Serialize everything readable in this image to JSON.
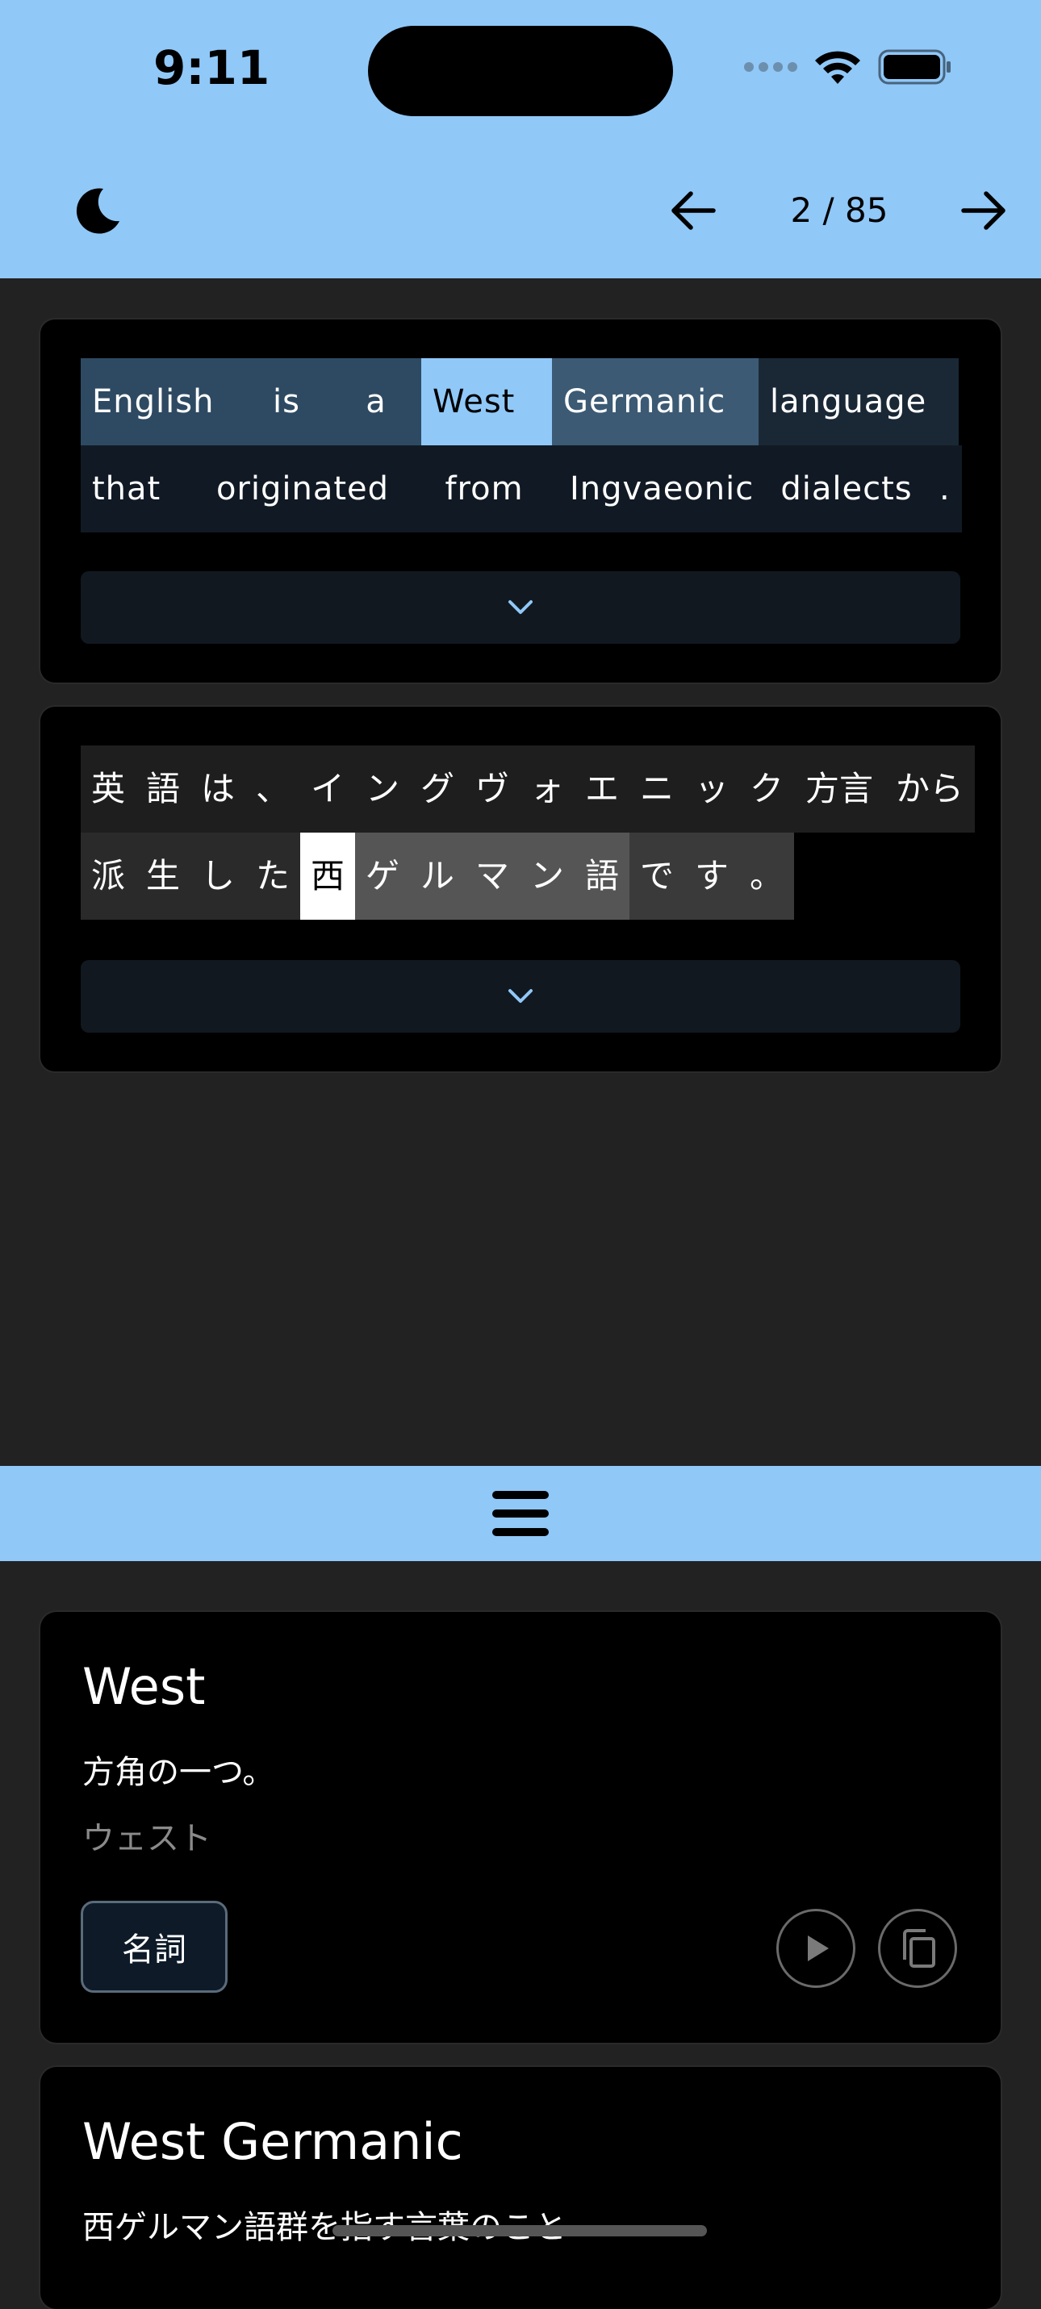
{
  "status_bar": {
    "time": "9:11"
  },
  "toolbar": {
    "page_indicator": "2 / 85"
  },
  "english_sentence": {
    "rows": [
      [
        {
          "text": "English",
          "bg": "#2e4a62"
        },
        {
          "text": "is",
          "bg": "#2e4a62"
        },
        {
          "text": "a",
          "bg": "#2e4a62"
        },
        {
          "text": "West",
          "bg": "#90c8f8",
          "color": "#000"
        },
        {
          "text": "Germanic",
          "bg": "#3c5a74"
        },
        {
          "text": "language",
          "bg": "#1a2836"
        }
      ],
      [
        {
          "text": "that",
          "bg": "#111a24"
        },
        {
          "text": "originated",
          "bg": "#111a24"
        },
        {
          "text": "from",
          "bg": "#111a24"
        },
        {
          "text": "Ingvaeonic",
          "bg": "#111a24"
        },
        {
          "text": "dialects",
          "bg": "#111a24"
        },
        {
          "text": ".",
          "bg": "#111a24"
        }
      ]
    ]
  },
  "japanese_sentence": {
    "rows": [
      [
        {
          "text": "英",
          "bg": "#1e1e1e"
        },
        {
          "text": "語",
          "bg": "#1e1e1e"
        },
        {
          "text": "は",
          "bg": "#1e1e1e"
        },
        {
          "text": "、",
          "bg": "#1e1e1e"
        },
        {
          "text": "イ",
          "bg": "#1e1e1e"
        },
        {
          "text": "ン",
          "bg": "#1e1e1e"
        },
        {
          "text": "グ",
          "bg": "#1e1e1e"
        },
        {
          "text": "ヴ",
          "bg": "#1e1e1e"
        },
        {
          "text": "ォ",
          "bg": "#1e1e1e"
        },
        {
          "text": "エ",
          "bg": "#1e1e1e"
        },
        {
          "text": "ニ",
          "bg": "#1e1e1e"
        },
        {
          "text": "ッ",
          "bg": "#1e1e1e"
        },
        {
          "text": "ク",
          "bg": "#1e1e1e"
        },
        {
          "text": "方言",
          "bg": "#1e1e1e"
        },
        {
          "text": "から",
          "bg": "#1e1e1e"
        }
      ],
      [
        {
          "text": "派",
          "bg": "#2a2a2a"
        },
        {
          "text": "生",
          "bg": "#2a2a2a"
        },
        {
          "text": "し",
          "bg": "#2a2a2a"
        },
        {
          "text": "た",
          "bg": "#2a2a2a"
        },
        {
          "text": "西",
          "bg": "#ffffff",
          "color": "#000"
        },
        {
          "text": "ゲ",
          "bg": "#555555"
        },
        {
          "text": "ル",
          "bg": "#555555"
        },
        {
          "text": "マ",
          "bg": "#555555"
        },
        {
          "text": "ン",
          "bg": "#555555"
        },
        {
          "text": "語",
          "bg": "#555555"
        },
        {
          "text": "で",
          "bg": "#3a3a3a"
        },
        {
          "text": "す",
          "bg": "#3a3a3a"
        },
        {
          "text": "。",
          "bg": "#3a3a3a"
        }
      ]
    ]
  },
  "dictionary": [
    {
      "word": "West",
      "meaning": "方角の一つ。",
      "reading": "ウェスト",
      "part_of_speech": "名詞"
    },
    {
      "word": "West Germanic",
      "meaning": "西ゲルマン語群を指す言葉のこと"
    }
  ],
  "colors": {
    "accent": "#90c8f8",
    "background": "#222222"
  }
}
